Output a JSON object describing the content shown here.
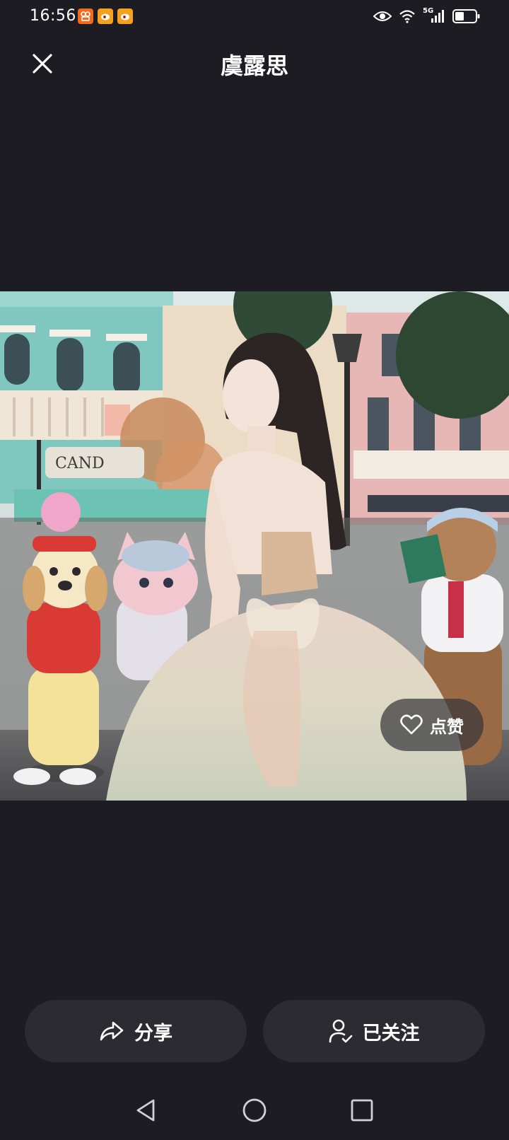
{
  "status_bar": {
    "time": "16:56",
    "notification_icons": [
      {
        "name": "kuaishou-app-icon",
        "color": "#f26a1b"
      },
      {
        "name": "weibo-app-icon",
        "color": "#f4a11d"
      },
      {
        "name": "weibo-app-icon",
        "color": "#f4a11d"
      }
    ],
    "network": "5G",
    "icons": [
      "eye-icon",
      "wifi-icon",
      "signal-icon",
      "battery-icon"
    ]
  },
  "header": {
    "title": "虞露思",
    "close_icon": "close-icon"
  },
  "photo": {
    "like_label": "点赞",
    "like_icon": "heart-icon",
    "storefront_sign": "CAND"
  },
  "actions": {
    "share_label": "分享",
    "share_icon": "share-icon",
    "follow_label": "已关注",
    "follow_icon": "user-check-icon"
  },
  "nav": [
    "back-icon",
    "home-icon",
    "recents-icon"
  ],
  "colors": {
    "background": "#1d1c22",
    "button_bg": "#2c2b31",
    "text": "#ffffff"
  }
}
